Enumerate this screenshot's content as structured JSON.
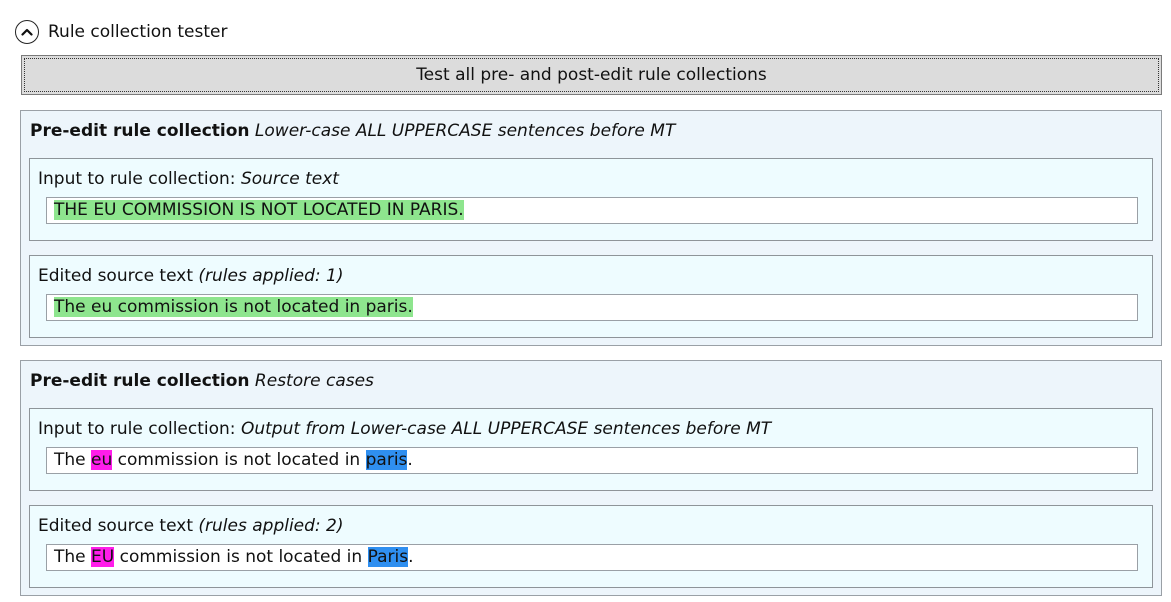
{
  "panel": {
    "title": "Rule collection tester",
    "expand_icon": "chevron-up-icon"
  },
  "test_button": {
    "label": "Test all pre- and post-edit rule collections"
  },
  "colors": {
    "match_green": "#8ee58e",
    "match_magenta": "#ff1dea",
    "match_blue": "#2f8ff0"
  },
  "collections": [
    {
      "heading": "Pre-edit rule collection",
      "name": "Lower-case ALL UPPERCASE sentences before MT",
      "input": {
        "label": "Input to rule collection:",
        "source": "Source text",
        "text": {
          "full": "THE EU COMMISSION IS NOT LOCATED IN PARIS."
        }
      },
      "output": {
        "label": "Edited source text",
        "rules_applied": "(rules applied: 1)",
        "text": {
          "full": "The eu commission is not located in paris."
        }
      }
    },
    {
      "heading": "Pre-edit rule collection",
      "name": "Restore cases",
      "input": {
        "label": "Input to rule collection:",
        "source": "Output from Lower-case ALL UPPERCASE sentences before MT",
        "text": {
          "pre": "The ",
          "m1": "eu",
          "mid": " commission is not located in ",
          "m2": "paris",
          "post": "."
        }
      },
      "output": {
        "label": "Edited source text",
        "rules_applied": "(rules applied: 2)",
        "text": {
          "pre": "The ",
          "m1": "EU",
          "mid": " commission is not located in ",
          "m2": "Paris",
          "post": "."
        }
      }
    }
  ]
}
